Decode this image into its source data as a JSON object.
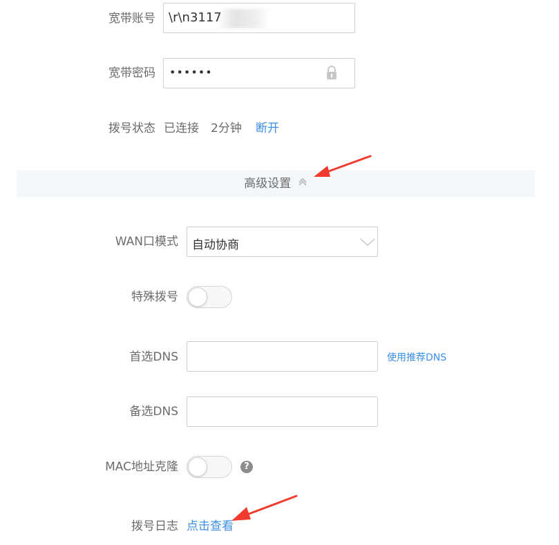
{
  "broadband": {
    "account_label": "宽带账号",
    "account_value": "\\r\\n3117",
    "password_label": "宽带密码",
    "password_value": "••••••",
    "dial_status_label": "拨号状态",
    "dial_status_value": "已连接",
    "dial_duration": "2分钟",
    "disconnect_link": "断开"
  },
  "advanced": {
    "label": "高级设置",
    "wan_mode_label": "WAN口模式",
    "wan_mode_value": "自动协商",
    "special_dial_label": "特殊拨号",
    "primary_dns_label": "首选DNS",
    "use_recommended_dns": "使用推荐DNS",
    "secondary_dns_label": "备选DNS",
    "mac_clone_label": "MAC地址克隆",
    "help_glyph": "?",
    "dial_log_label": "拨号日志",
    "dial_log_link": "点击查看"
  },
  "colors": {
    "link": "#3a8ee6",
    "arrow": "#f23b2f",
    "advanced_bar_bg": "#f4f7fa"
  },
  "icons": [
    "lock-icon",
    "chevron-up-icon",
    "chevron-down-icon",
    "help-icon",
    "arrow-annotation"
  ]
}
